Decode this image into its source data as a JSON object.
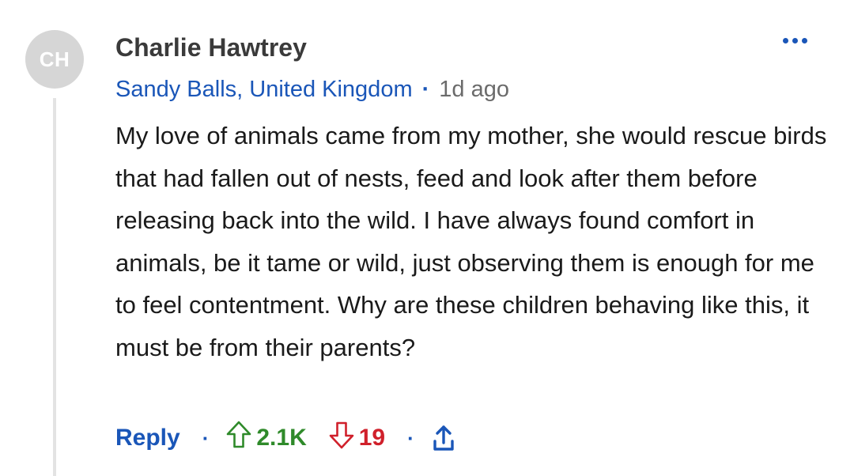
{
  "comment": {
    "avatar_initials": "CH",
    "author": "Charlie Hawtrey",
    "location": "Sandy Balls, United Kingdom",
    "meta_separator": "·",
    "time_ago": "1d ago",
    "body": "My love of animals came from my mother, she would rescue birds that had fallen out of nests, feed and look after them before releasing back into the wild. I have always found comfort in animals, be it tame or wild, just observing them is enough for me to feel contentment. Why are these children behaving like this, it must be from their parents?"
  },
  "actions": {
    "reply_label": "Reply",
    "separator": "·",
    "upvotes": "2.1K",
    "downvotes": "19"
  },
  "icons": {
    "more": "more-dots-icon",
    "upvote": "arrow-up-outline-icon",
    "downvote": "arrow-down-outline-icon",
    "share": "share-upload-icon"
  },
  "colors": {
    "accent_blue": "#1a56b8",
    "upvote_green": "#2f8a2a",
    "downvote_red": "#d0202b",
    "avatar_bg": "#d6d6d6"
  }
}
